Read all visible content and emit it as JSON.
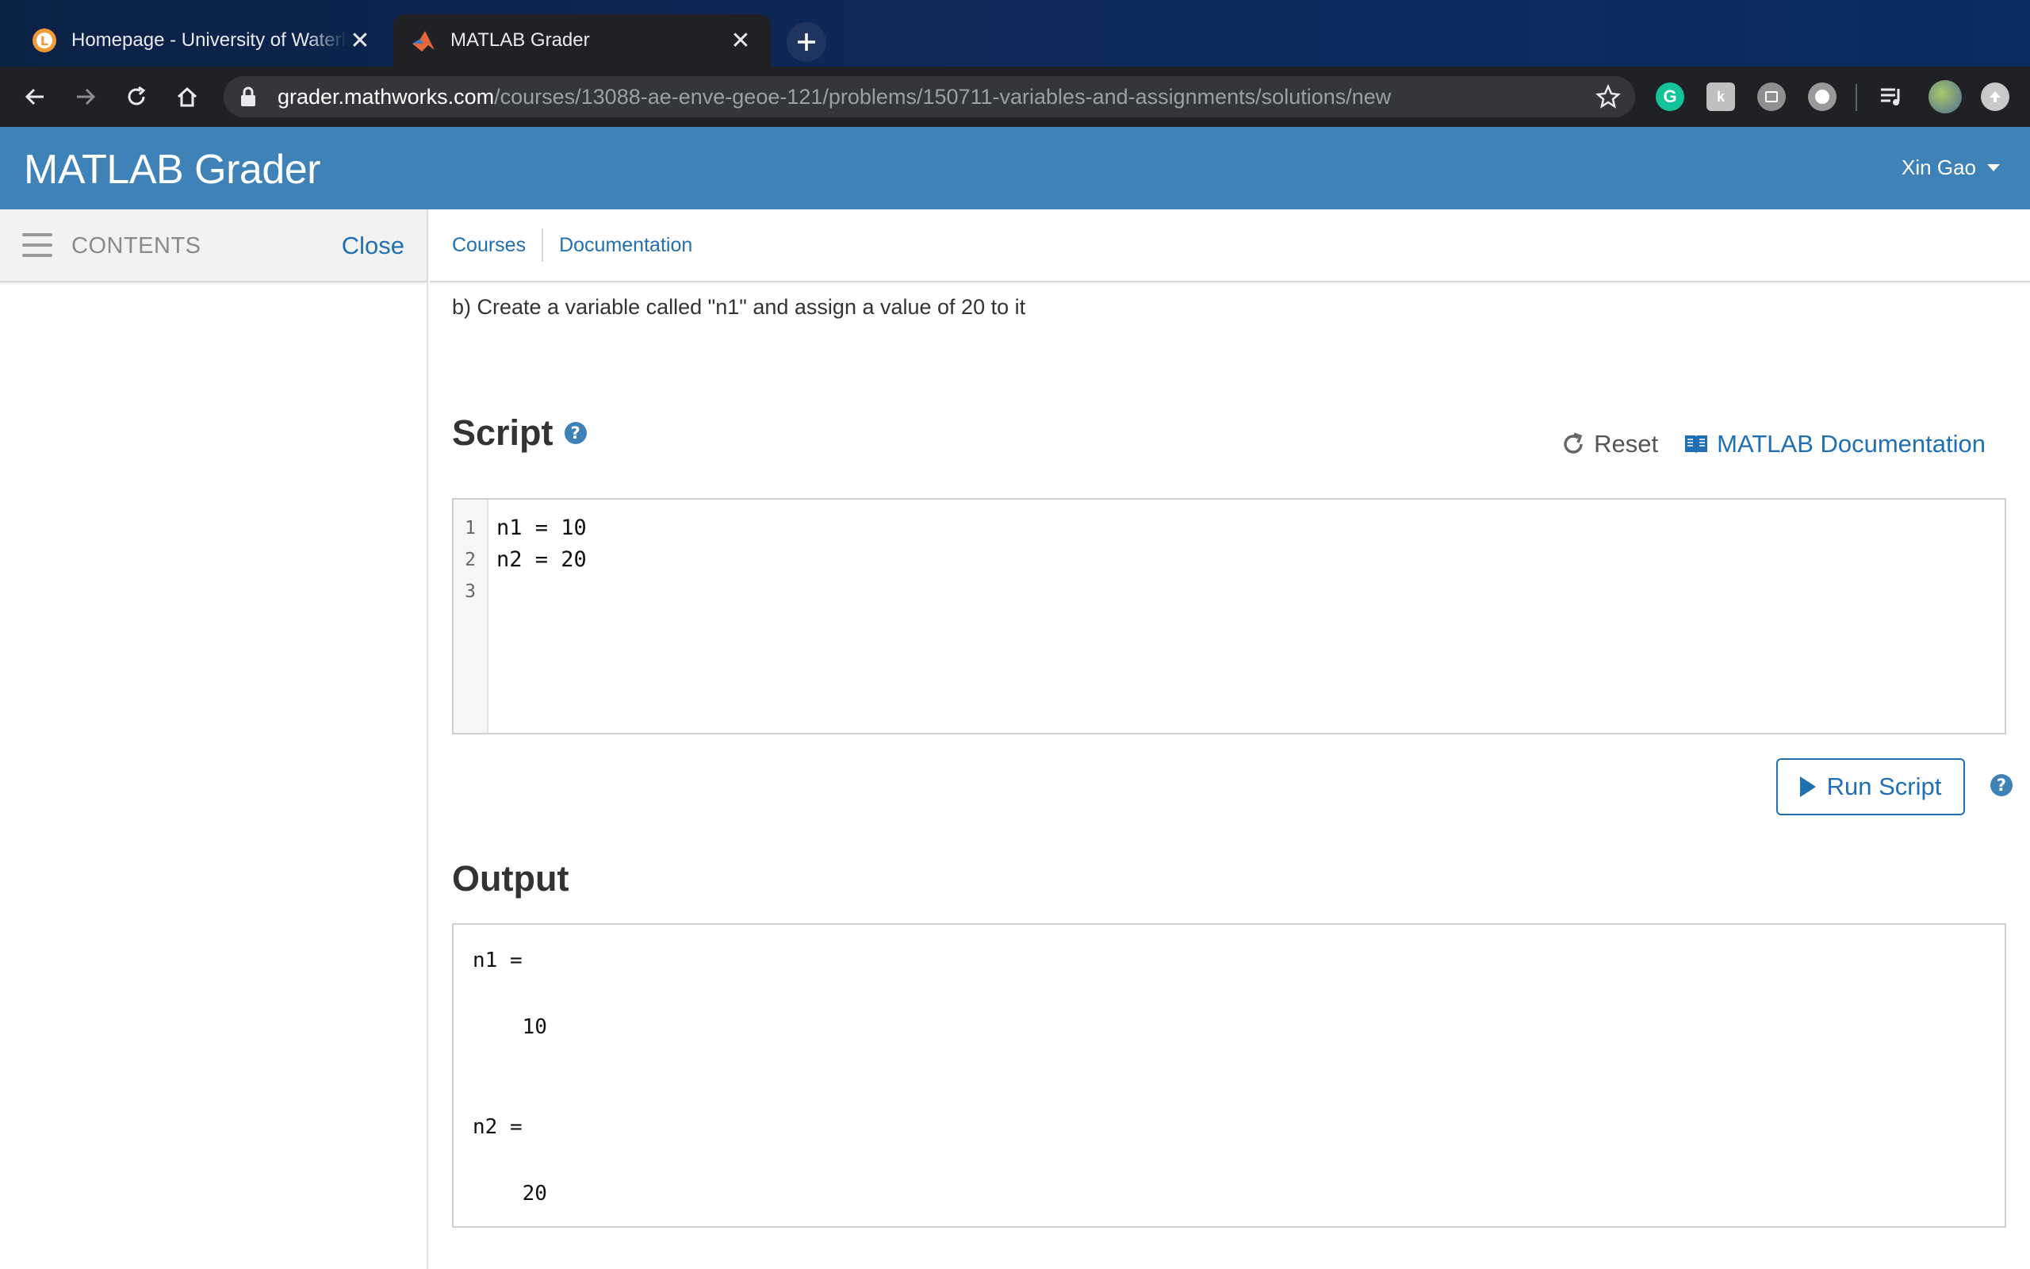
{
  "browser": {
    "tabs": [
      {
        "title": "Homepage - University of Waterloo",
        "active": false,
        "favicon": "learn-icon"
      },
      {
        "title": "MATLAB Grader",
        "active": true,
        "favicon": "matlab-icon"
      }
    ],
    "url_host": "grader.mathworks.com",
    "url_path": "/courses/13088-ae-enve-geoe-121/problems/150711-variables-and-assignments/solutions/new",
    "extensions": [
      "grammarly-icon",
      "extension-icon",
      "calendar-extension-icon",
      "circle-extension-icon",
      "media-queue-icon",
      "profile-avatar",
      "update-icon"
    ]
  },
  "app": {
    "title": "MATLAB Grader",
    "user": "Xin Gao"
  },
  "sidebar": {
    "contents_label": "CONTENTS",
    "close_label": "Close"
  },
  "breadcrumbs": [
    {
      "label": "Courses"
    },
    {
      "label": "Documentation"
    }
  ],
  "problem": {
    "instruction": "b) Create a variable called \"n1\" and assign a value of 20 to it"
  },
  "script": {
    "title": "Script",
    "reset_label": "Reset",
    "doc_label": "MATLAB Documentation",
    "line_numbers": [
      "1",
      "2",
      "3"
    ],
    "lines": [
      "n1 = 10",
      "n2 = 20",
      ""
    ],
    "run_label": "Run Script"
  },
  "output": {
    "title": "Output",
    "lines": [
      "n1 =",
      "",
      "    10",
      "",
      "",
      "n2 =",
      "",
      "    20"
    ]
  },
  "colors": {
    "header_blue": "#3e82b8",
    "link_blue": "#1f6fb2",
    "chrome_dark": "#202124"
  }
}
